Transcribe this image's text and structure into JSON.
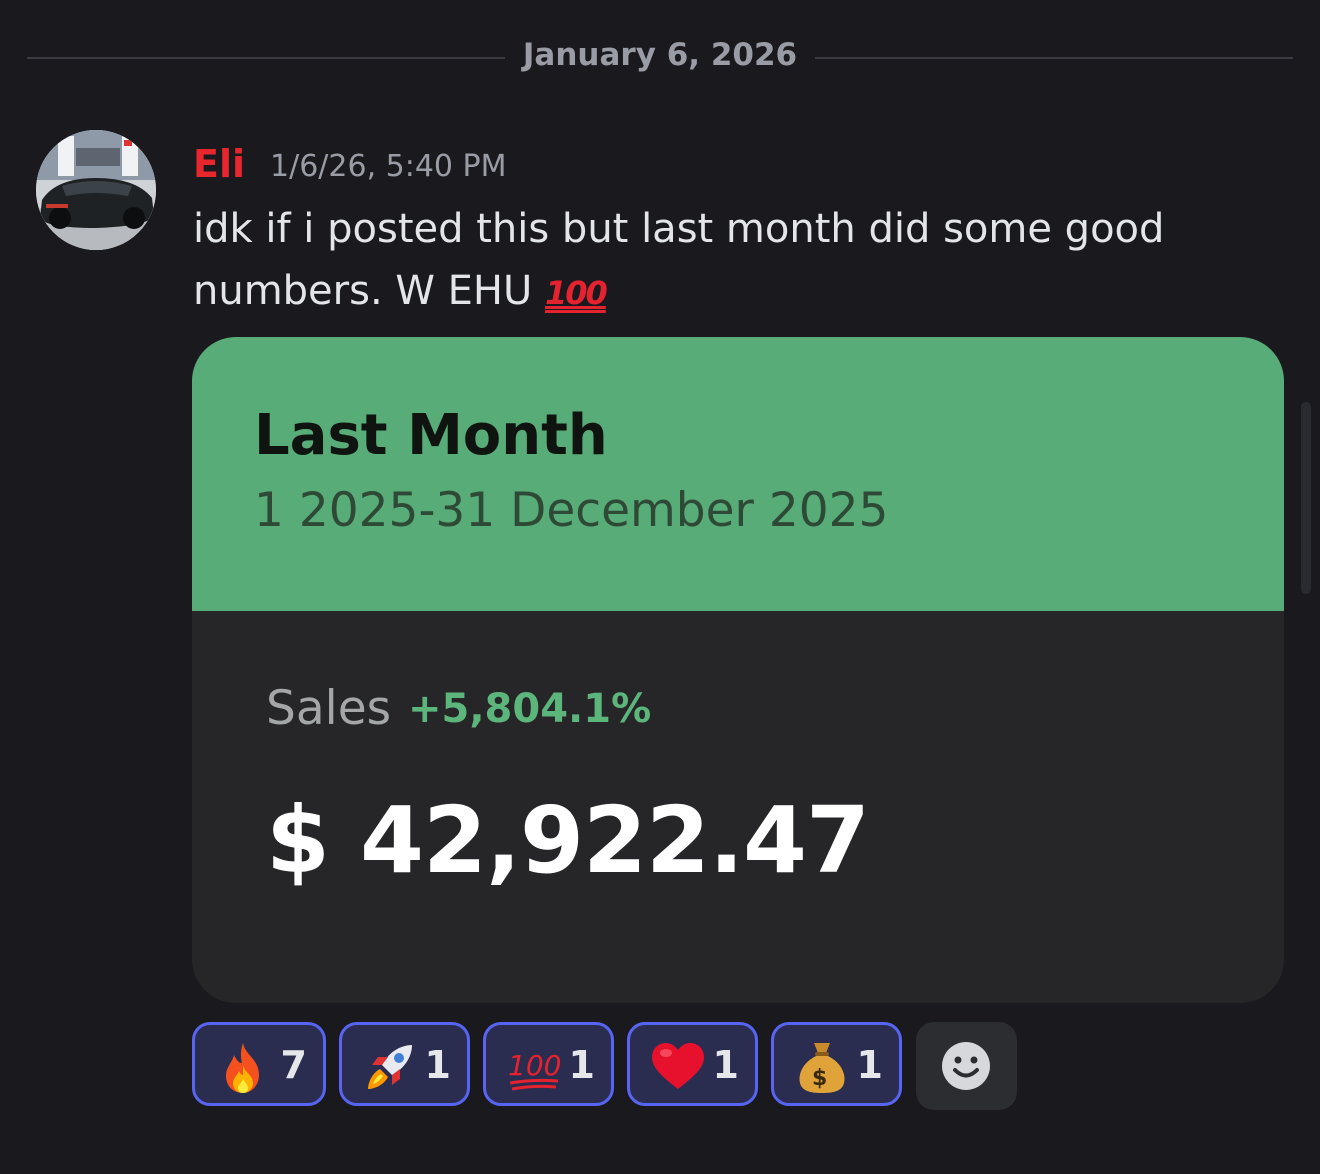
{
  "date_divider": "January 6, 2026",
  "message": {
    "author": "Eli",
    "timestamp": "1/6/26, 5:40 PM",
    "text": "idk if i posted this but last month did some good numbers. W EHU",
    "text_emoji": "100",
    "avatar": "car-avatar"
  },
  "card": {
    "title": "Last Month",
    "range": "1 2025-31 December 2025",
    "sales_label": "Sales",
    "sales_change": "+5,804.1%",
    "sales_amount": "$ 42,922.47",
    "header_color": "#57ac78",
    "body_color": "#262628"
  },
  "reactions": [
    {
      "icon": "fire-icon",
      "count": "7"
    },
    {
      "icon": "rocket-icon",
      "count": "1"
    },
    {
      "icon": "hundred-points-icon",
      "count": "1",
      "glyph": "100"
    },
    {
      "icon": "red-heart-icon",
      "count": "1"
    },
    {
      "icon": "money-bag-icon",
      "count": "1"
    }
  ],
  "colors": {
    "background": "#1a1a1e",
    "username": "#e8262d",
    "reaction_border": "#5865f2",
    "positive_change": "#5cb57b"
  },
  "add_reaction_icon": "smiley-add-reaction-icon"
}
